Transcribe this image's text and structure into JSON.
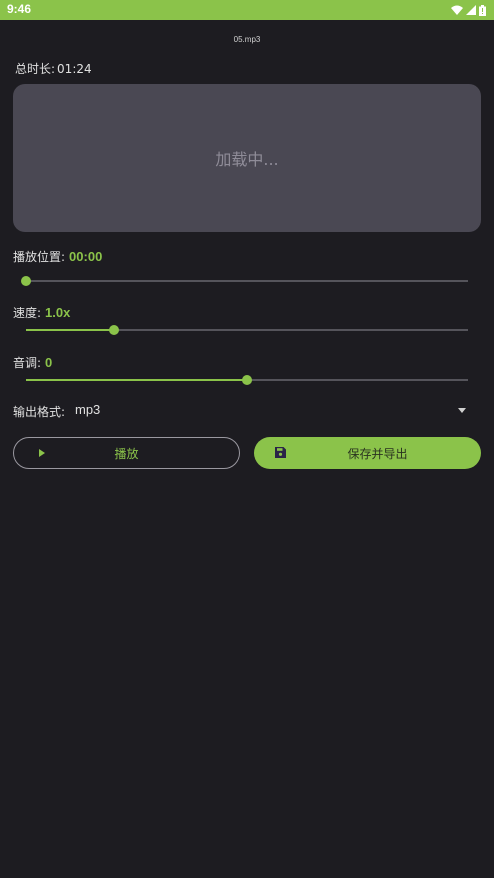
{
  "status_bar": {
    "time": "9:46",
    "icons": [
      "wifi-icon",
      "signal-icon",
      "battery-icon"
    ]
  },
  "file": {
    "name": "05.mp3"
  },
  "duration": {
    "label": "总时长:",
    "value": "01:24"
  },
  "waveform": {
    "loading_text": "加载中..."
  },
  "position": {
    "label": "播放位置:",
    "value": "00:00",
    "level": 0.0
  },
  "speed": {
    "label": "速度:",
    "value": "1.0x",
    "level": 0.2
  },
  "pitch": {
    "label": "音调:",
    "value": "0",
    "level": 0.5
  },
  "output_format": {
    "label": "输出格式:",
    "value": "mp3"
  },
  "buttons": {
    "play": "播放",
    "save_export": "保存并导出"
  },
  "colors": {
    "accent": "#8bc34a",
    "background": "#1d1c21",
    "panel": "#4a4853"
  }
}
